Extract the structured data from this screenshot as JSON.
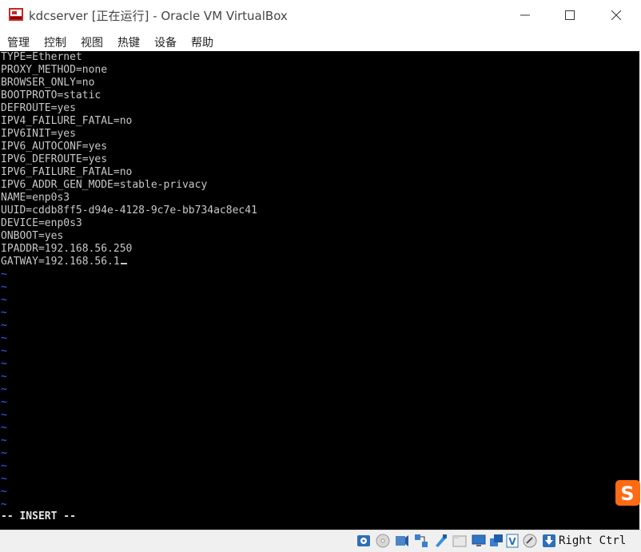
{
  "window": {
    "title": "kdcserver [正在运行] - Oracle VM VirtualBox",
    "controls": [
      "minimize",
      "maximize",
      "close"
    ]
  },
  "menu": [
    "管理",
    "控制",
    "视图",
    "热键",
    "设备",
    "帮助"
  ],
  "terminal": {
    "lines": [
      "TYPE=Ethernet",
      "PROXY_METHOD=none",
      "BROWSER_ONLY=no",
      "BOOTPROTO=static",
      "DEFROUTE=yes",
      "IPV4_FAILURE_FATAL=no",
      "IPV6INIT=yes",
      "IPV6_AUTOCONF=yes",
      "IPV6_DEFROUTE=yes",
      "IPV6_FAILURE_FATAL=no",
      "IPV6_ADDR_GEN_MODE=stable-privacy",
      "NAME=enp0s3",
      "UUID=cddb8ff5-d94e-4128-9c7e-bb734ac8ec41",
      "DEVICE=enp0s3",
      "ONBOOT=yes",
      "IPADDR=192.168.56.250",
      "GATWAY=192.168.56.1"
    ],
    "tilde": "~",
    "tilde_count": 19,
    "mode": "-- INSERT --",
    "text_color": "#c8c8c8",
    "tilde_color": "#3a66ff"
  },
  "ime_icon": "sogou-s-icon",
  "statusbar": {
    "icons": [
      "hard-disk-icon",
      "optical-drive-icon",
      "audio-icon",
      "network-icon",
      "usb-icon",
      "shared-folder-icon",
      "display-icon",
      "video-capture-icon",
      "cpu-icon",
      "mouse-integration-icon",
      "keyboard-arrow-icon"
    ],
    "host_key": "Right Ctrl"
  }
}
